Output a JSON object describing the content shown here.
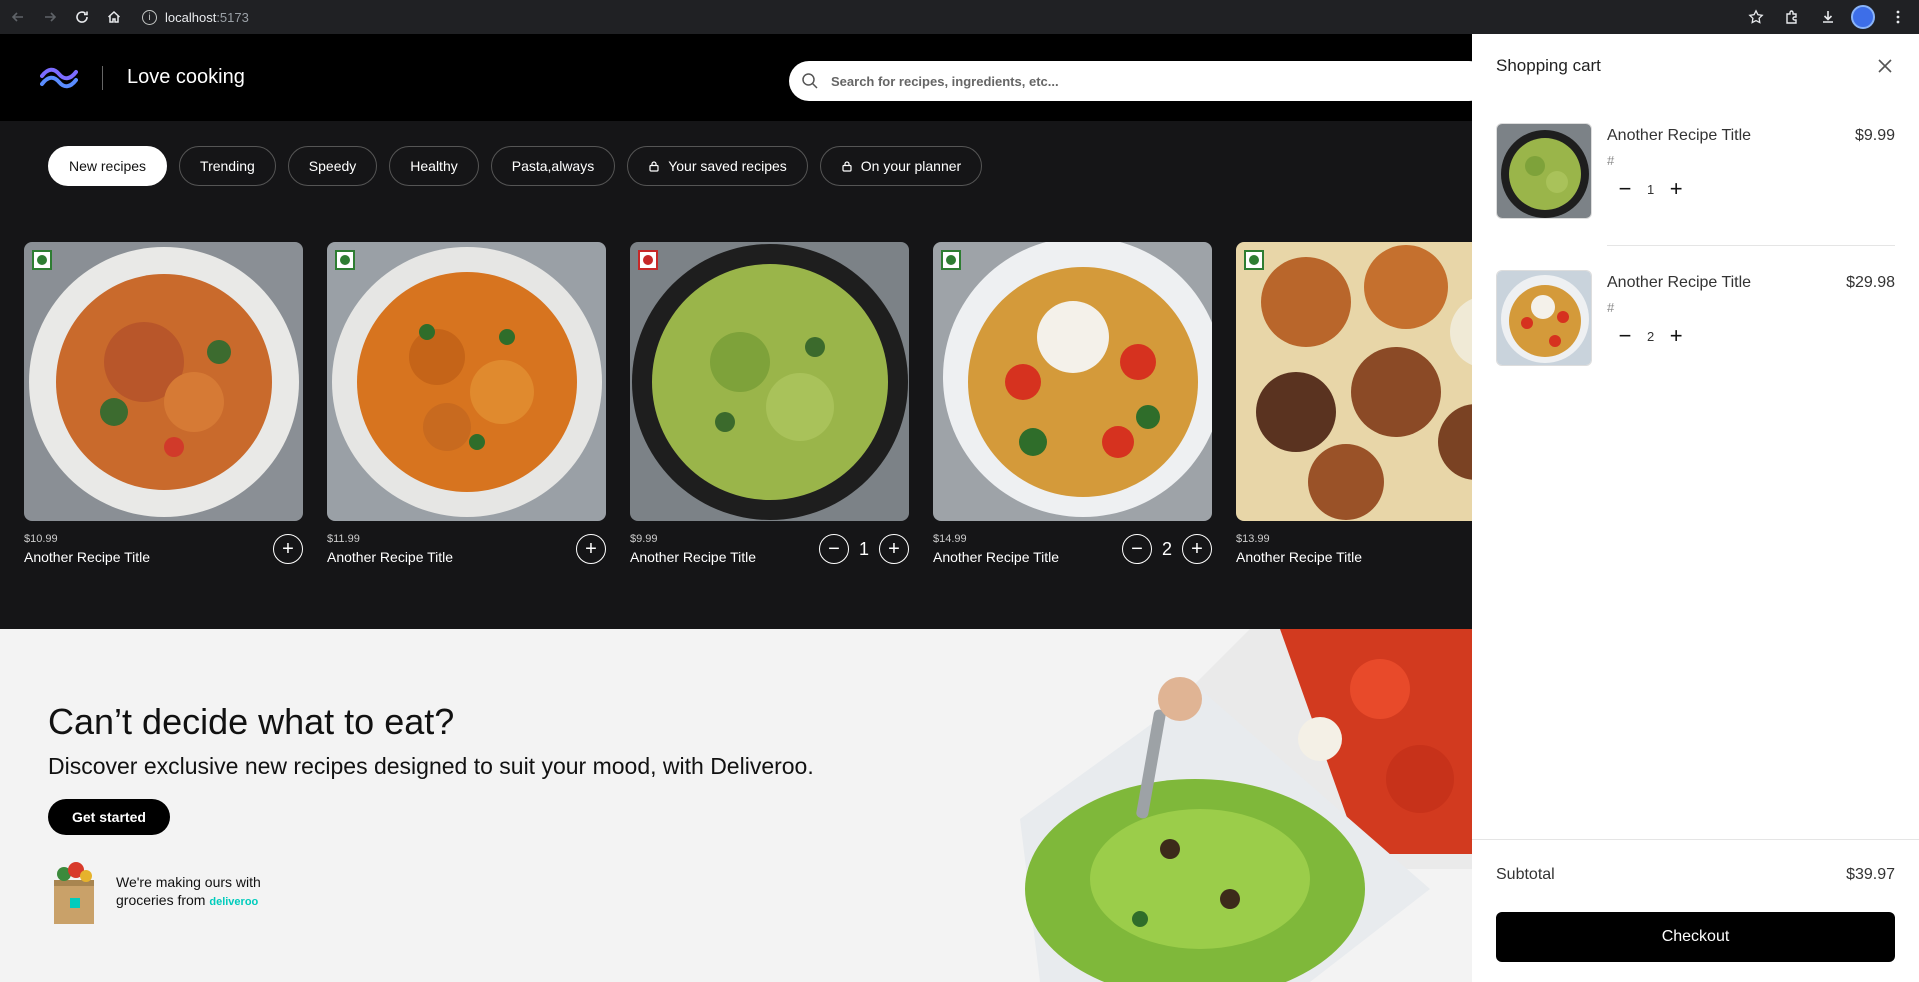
{
  "browser": {
    "host": "localhost",
    "port": ":5173"
  },
  "header": {
    "brand": "Love cooking",
    "search_placeholder": "Search for recipes, ingredients, etc..."
  },
  "chips": [
    {
      "label": "New recipes",
      "active": true
    },
    {
      "label": "Trending"
    },
    {
      "label": "Speedy"
    },
    {
      "label": "Healthy"
    },
    {
      "label": "Pasta,always"
    },
    {
      "label": "Your saved recipes",
      "icon": "lock-icon"
    },
    {
      "label": "On your planner",
      "icon": "lock-icon"
    }
  ],
  "cards": [
    {
      "price": "$10.99",
      "title": "Another Recipe Title",
      "diet": "veg",
      "qty": null
    },
    {
      "price": "$11.99",
      "title": "Another Recipe Title",
      "diet": "veg",
      "qty": null
    },
    {
      "price": "$9.99",
      "title": "Another Recipe Title",
      "diet": "non-veg",
      "qty": "1"
    },
    {
      "price": "$14.99",
      "title": "Another Recipe Title",
      "diet": "veg",
      "qty": "2"
    },
    {
      "price": "$13.99",
      "title": "Another Recipe Title",
      "diet": "veg",
      "qty": null
    }
  ],
  "promo": {
    "heading": "Can’t decide what to eat?",
    "subheading": "Discover exclusive new recipes designed to suit your mood, with Deliveroo.",
    "cta": "Get started",
    "making_line1": "We're making ours with",
    "making_line2": "groceries from",
    "partner": "deliveroo"
  },
  "cart": {
    "title": "Shopping cart",
    "items": [
      {
        "name": "Another Recipe Title",
        "hash": "#",
        "price": "$9.99",
        "qty": "1"
      },
      {
        "name": "Another Recipe Title",
        "hash": "#",
        "price": "$29.98",
        "qty": "2"
      }
    ],
    "subtotal_label": "Subtotal",
    "subtotal_value": "$39.97",
    "checkout_label": "Checkout"
  },
  "colors": {
    "accent": "#000000",
    "brand_logo": "#6c63ff",
    "deliveroo": "#00ccbc"
  }
}
